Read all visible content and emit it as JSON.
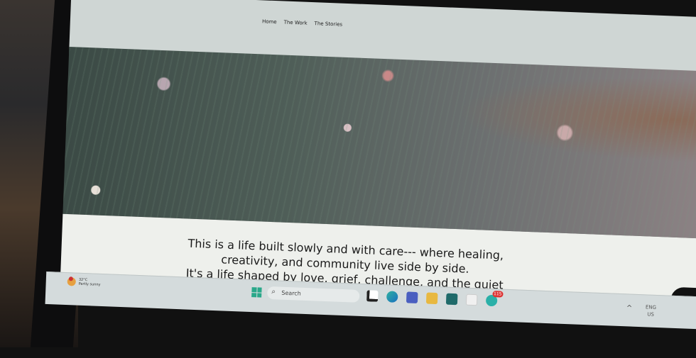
{
  "nav": {
    "items": [
      "Home",
      "The Work",
      "The Stories"
    ]
  },
  "content": {
    "lines": [
      "This is a life built slowly and with care--- where healing,",
      "creativity, and community live side by side.",
      "It's a life shaped by love, grief, challenge, and the quiet"
    ]
  },
  "taskbar": {
    "weather_temp": "32°C",
    "weather_desc": "Partly sunny",
    "search_placeholder": "Search",
    "notification_count": "115",
    "lang": "ENG",
    "region": "US"
  }
}
